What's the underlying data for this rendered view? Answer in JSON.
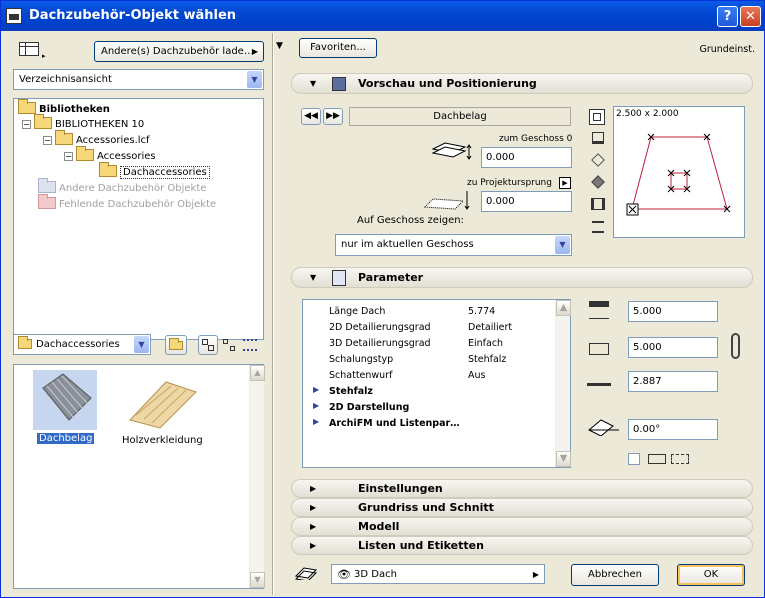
{
  "window": {
    "title": "Dachzubehör-Objekt wählen",
    "help": "?",
    "close": "✕"
  },
  "left": {
    "library_combo": "Andere(s) Dachzubehör lade…",
    "view_combo": "Verzeichnisansicht",
    "tree": {
      "root": "Bibliotheken",
      "lib": "BIBLIOTHEKEN 10",
      "lcf": "Accessories.lcf",
      "acc": "Accessories",
      "dach": "Dachaccessories",
      "other": "Andere Dachzubehör Objekte",
      "missing": "Fehlende Dachzubehör Objekte"
    },
    "folder_combo": "Dachaccessories",
    "items": [
      {
        "label": "Dachbelag"
      },
      {
        "label": "Holzverkleidung"
      }
    ]
  },
  "right": {
    "favorites": "Favoriten...",
    "grundeinst": "Grundeinst.",
    "preview": {
      "title": "Vorschau und Positionierung",
      "name": "Dachbelag",
      "zum_geschoss": "zum Geschoss 0",
      "value1": "0.000",
      "zu_projekt": "zu Projektursprung",
      "value2": "0.000",
      "auf_geschoss": "Auf Geschoss zeigen:",
      "geschoss_combo": "nur im aktuellen Geschoss",
      "dims": "2.500 x 2.000"
    },
    "parameter": {
      "title": "Parameter",
      "rows": [
        {
          "name": "Länge Dach",
          "value": "5.774"
        },
        {
          "name": "2D Detailierungsgrad",
          "value": "Detailiert"
        },
        {
          "name": "3D Detailierungsgrad",
          "value": "Einfach"
        },
        {
          "name": "Schalungstyp",
          "value": "Stehfalz"
        },
        {
          "name": "Schattenwurf",
          "value": "Aus"
        }
      ],
      "groups": [
        "Stehfalz",
        "2D Darstellung",
        "ArchiFM und Listenpar…"
      ],
      "width": "5.000",
      "height": "5.000",
      "elev": "2.887",
      "angle": "0.00°"
    },
    "sections": [
      "Einstellungen",
      "Grundriss und Schnitt",
      "Modell",
      "Listen und Etiketten"
    ],
    "bottom_combo": "3D Dach",
    "cancel": "Abbrechen",
    "ok": "OK"
  },
  "colors": {
    "titlebar": "#0347d0",
    "selection": "#316ac5",
    "preview_line": "#c0203a"
  }
}
